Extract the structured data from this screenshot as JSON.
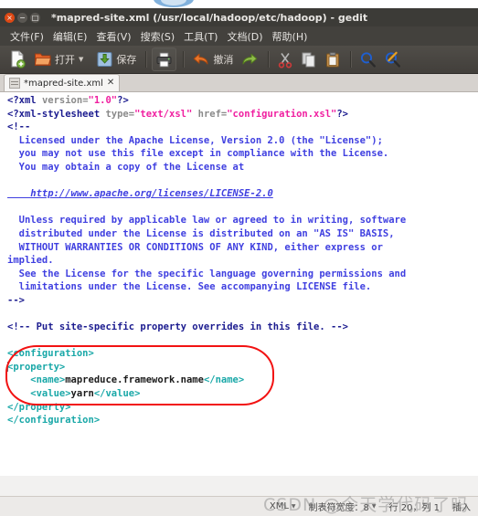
{
  "window": {
    "title": "*mapred-site.xml (/usr/local/hadoop/etc/hadoop) - gedit",
    "close_glyph": "×",
    "min_glyph": "−",
    "max_glyph": "□"
  },
  "menubar": {
    "items": [
      {
        "label": "文件(F)",
        "name": "menu-file"
      },
      {
        "label": "编辑(E)",
        "name": "menu-edit"
      },
      {
        "label": "查看(V)",
        "name": "menu-view"
      },
      {
        "label": "搜索(S)",
        "name": "menu-search"
      },
      {
        "label": "工具(T)",
        "name": "menu-tools"
      },
      {
        "label": "文档(D)",
        "name": "menu-documents"
      },
      {
        "label": "帮助(H)",
        "name": "menu-help"
      }
    ]
  },
  "toolbar": {
    "new_label": "",
    "open_label": "打开",
    "open_caret": "▼",
    "save_label": "保存",
    "print_label": "",
    "undo_label": "撤消",
    "redo_label": "",
    "cut_label": "",
    "copy_label": "",
    "paste_label": "",
    "find_label": "",
    "replace_label": ""
  },
  "tabs": [
    {
      "label": "*mapred-site.xml",
      "close": "✕"
    }
  ],
  "editor": {
    "lines": [
      {
        "type": "pi",
        "text": "<?xml version=\"1.0\"?>"
      },
      {
        "type": "pi",
        "text": "<?xml-stylesheet type=\"text/xsl\" href=\"configuration.xsl\"?>"
      },
      {
        "type": "comment",
        "text": "<!--"
      },
      {
        "type": "comment",
        "text": "  Licensed under the Apache License, Version 2.0 (the \"License\");"
      },
      {
        "type": "comment",
        "text": "  you may not use this file except in compliance with the License."
      },
      {
        "type": "comment",
        "text": "  You may obtain a copy of the License at"
      },
      {
        "type": "blank",
        "text": ""
      },
      {
        "type": "link",
        "text": "    http://www.apache.org/licenses/LICENSE-2.0"
      },
      {
        "type": "blank",
        "text": ""
      },
      {
        "type": "comment",
        "text": "  Unless required by applicable law or agreed to in writing, software"
      },
      {
        "type": "comment",
        "text": "  distributed under the License is distributed on an \"AS IS\" BASIS,"
      },
      {
        "type": "comment",
        "text": "  WITHOUT WARRANTIES OR CONDITIONS OF ANY KIND, either express or"
      },
      {
        "type": "comment",
        "text": "implied."
      },
      {
        "type": "comment",
        "text": "  See the License for the specific language governing permissions and"
      },
      {
        "type": "comment",
        "text": "  limitations under the License. See accompanying LICENSE file."
      },
      {
        "type": "comment",
        "text": "-->"
      },
      {
        "type": "blank",
        "text": ""
      },
      {
        "type": "comment",
        "text": "<!-- Put site-specific property overrides in this file. -->"
      },
      {
        "type": "blank",
        "text": ""
      },
      {
        "type": "tag",
        "text": "<configuration>"
      },
      {
        "type": "tag-caret",
        "text": "<property>"
      },
      {
        "type": "namevalue",
        "indent": "    ",
        "open": "<name>",
        "value": "mapreduce.framework.name",
        "close": "</name>"
      },
      {
        "type": "namevalue",
        "indent": "    ",
        "open": "<value>",
        "value": "yarn",
        "close": "</value>"
      },
      {
        "type": "tag",
        "text": "</property>"
      },
      {
        "type": "tag",
        "text": "</configuration>"
      }
    ]
  },
  "statusbar": {
    "language": "XML",
    "language_caret": "▼",
    "tab_width": "制表符宽度：8",
    "tab_width_caret": "▼",
    "position": "行 20，列 1",
    "insert_mode": "插入"
  },
  "watermark": {
    "text": "CSDN @今天学代码了吗"
  },
  "colors": {
    "titlebar_bg": "#3c3b37",
    "menubar_bg": "#43413d",
    "toolbar_bg": "#4a4742",
    "close_button": "#dd4814",
    "annotation": "#f21212",
    "xml_tag": "#1aa8a8",
    "xml_string": "#f01fa0",
    "xml_comment": "#3f3fe0"
  }
}
